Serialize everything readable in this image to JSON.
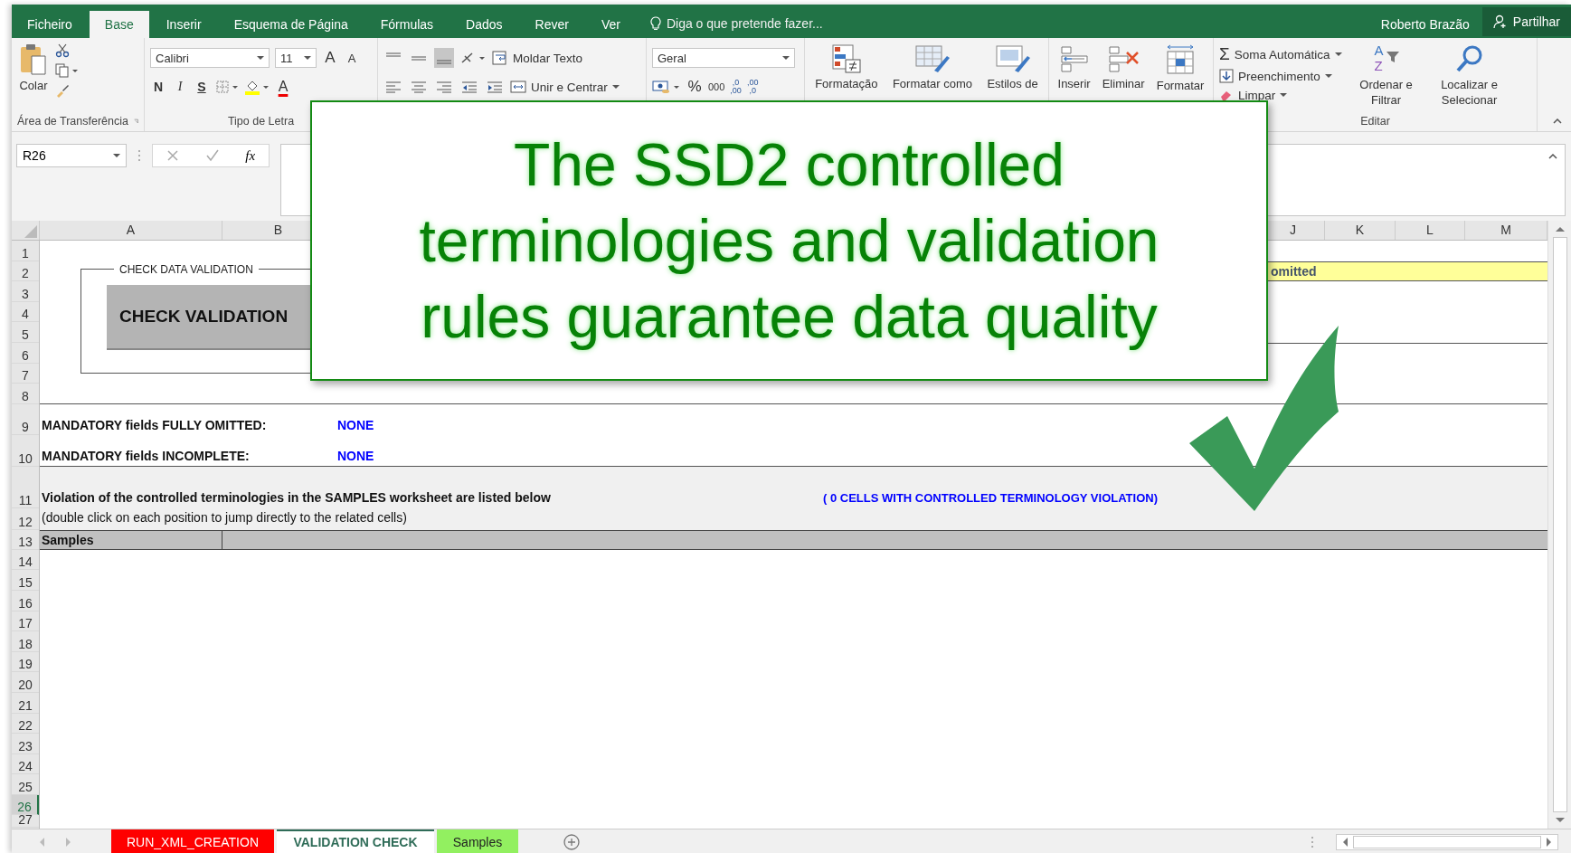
{
  "ribbon_tabs": [
    {
      "label": "Ficheiro",
      "selected": false
    },
    {
      "label": "Base",
      "selected": true
    },
    {
      "label": "Inserir",
      "selected": false
    },
    {
      "label": "Esquema de Página",
      "selected": false
    },
    {
      "label": "Fórmulas",
      "selected": false
    },
    {
      "label": "Dados",
      "selected": false
    },
    {
      "label": "Rever",
      "selected": false
    },
    {
      "label": "Ver",
      "selected": false
    }
  ],
  "tell_me": {
    "placeholder": "Diga o que pretende fazer..."
  },
  "user": "Roberto Brazão",
  "share_button": "Partilhar",
  "ribbon": {
    "clipboard": {
      "paste": "Colar",
      "group_label": "Área de Transferência"
    },
    "font": {
      "font_name": "Calibri",
      "font_size": "11",
      "grow": "A",
      "shrink": "A",
      "bold": "N",
      "italic": "I",
      "underline": "S",
      "font_color": "A",
      "group_label": "Tipo de Letra"
    },
    "alignment": {
      "wrap_text": "Moldar Texto",
      "merge_center": "Unir e Centrar"
    },
    "number": {
      "format": "Geral",
      "percent": "%",
      "thousands": "000",
      "increase_decimal": {
        "top": ",0",
        "bottom": ",00"
      },
      "decrease_decimal": {
        "top": ",00",
        "bottom": ",0"
      }
    },
    "styles": [
      "Formatação",
      "Formatar como",
      "Estilos de"
    ],
    "cells": [
      "Inserir",
      "Eliminar",
      "Formatar"
    ],
    "editing": {
      "autosum_icon": "Σ",
      "autosum": "Soma Automática",
      "fill": "Preenchimento",
      "clear": "Limpar",
      "sort_icon": {
        "top": "A",
        "bottom": "Z"
      },
      "sort_filter": "Ordenar e Filtrar",
      "find_select": "Localizar e Selecionar",
      "group_label": "Editar"
    }
  },
  "name_box": "R26",
  "function_button": "fx",
  "columns": [
    {
      "label": "A"
    },
    {
      "label": "B"
    },
    {
      "label": "J"
    },
    {
      "label": "K"
    },
    {
      "label": "L"
    },
    {
      "label": "M"
    }
  ],
  "rows": [
    {
      "label": "1",
      "selected": false
    },
    {
      "label": "2",
      "selected": false
    },
    {
      "label": "3",
      "selected": false
    },
    {
      "label": "4",
      "selected": false
    },
    {
      "label": "5",
      "selected": false
    },
    {
      "label": "6",
      "selected": false
    },
    {
      "label": "7",
      "selected": false
    },
    {
      "label": "8",
      "selected": false
    },
    {
      "label": "9",
      "selected": false
    },
    {
      "label": "10",
      "selected": false
    },
    {
      "label": "11",
      "selected": false
    },
    {
      "label": "12",
      "selected": false
    },
    {
      "label": "13",
      "selected": false
    },
    {
      "label": "14",
      "selected": false
    },
    {
      "label": "15",
      "selected": false
    },
    {
      "label": "16",
      "selected": false
    },
    {
      "label": "17",
      "selected": false
    },
    {
      "label": "18",
      "selected": false
    },
    {
      "label": "19",
      "selected": false
    },
    {
      "label": "20",
      "selected": false
    },
    {
      "label": "21",
      "selected": false
    },
    {
      "label": "22",
      "selected": false
    },
    {
      "label": "23",
      "selected": false
    },
    {
      "label": "24",
      "selected": false
    },
    {
      "label": "25",
      "selected": false
    },
    {
      "label": "26",
      "selected": true
    },
    {
      "label": "27",
      "selected": false
    }
  ],
  "sheet": {
    "validation_group": {
      "title": "CHECK DATA VALIDATION",
      "button": "CHECK VALIDATION"
    },
    "row2_note": "omitted",
    "mandatory": [
      {
        "label": "MANDATORY fields FULLY OMITTED:",
        "value": "NONE"
      },
      {
        "label": "MANDATORY fields INCOMPLETE:",
        "value": "NONE"
      }
    ],
    "violation_title": "Violation of the controlled terminologies in the SAMPLES worksheet are listed below",
    "violation_count": "( 0 CELLS WITH CONTROLLED TERMINOLOGY VIOLATION)",
    "violation_hint": "(double click on each position to jump directly to the related cells)",
    "table_header": "Samples"
  },
  "sheet_tabs": [
    {
      "label": "RUN_XML_CREATION",
      "selected": false,
      "color": "#ff0000"
    },
    {
      "label": "VALIDATION CHECK",
      "selected": true
    },
    {
      "label": "Samples",
      "selected": false,
      "color": "#92f060"
    }
  ],
  "callout": {
    "text": "The SSD2 controlled terminologies and validation rules guarantee data quality"
  }
}
